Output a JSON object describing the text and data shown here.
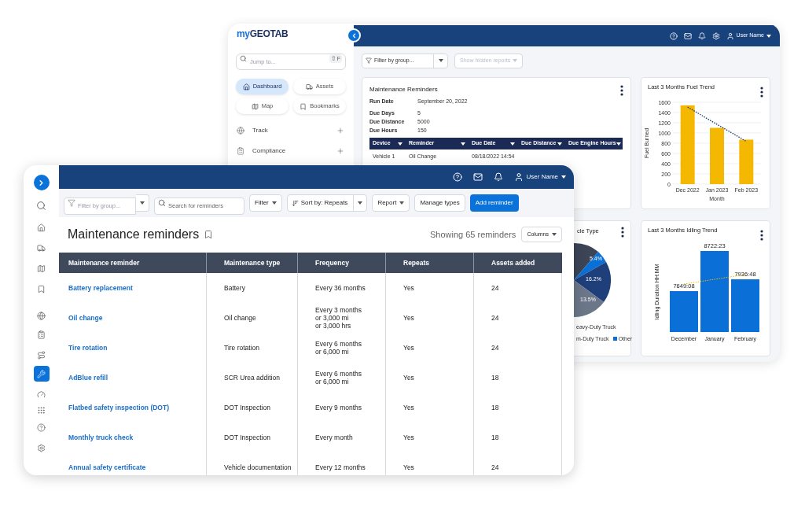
{
  "dashboard_window": {
    "logo": {
      "prefix": "my",
      "name": "GEOTAB"
    },
    "jump_search": {
      "placeholder": "Jump to...",
      "shortcut": "⇧F"
    },
    "quick_buttons": [
      {
        "label": "Dashboard",
        "selected": true
      },
      {
        "label": "Assets",
        "selected": false
      },
      {
        "label": "Map",
        "selected": false
      },
      {
        "label": "Bookmarks",
        "selected": false
      }
    ],
    "nav": [
      {
        "label": "Track"
      },
      {
        "label": "Compliance"
      }
    ],
    "header": {
      "user": "User Name"
    },
    "toolbar": {
      "group_filter": {
        "value": "Filter by group..."
      },
      "hidden_reports": {
        "label": "Show hidden reports",
        "disabled": true
      }
    },
    "reminders_card": {
      "title": "Maintenance Reminders",
      "fields": [
        {
          "label": "Run Date",
          "value": "September 20, 2022"
        },
        {
          "label": "Due Days",
          "value": "5"
        },
        {
          "label": "Due Distance",
          "value": "5000"
        },
        {
          "label": "Due Hours",
          "value": "150"
        }
      ],
      "columns": [
        "Device",
        "Reminder",
        "Due Date",
        "Due Distance",
        "Due Engine Hours"
      ],
      "rows": [
        [
          "Vehicle 1",
          "Oil Change",
          "08/18/2022 14:54"
        ]
      ]
    },
    "fuel_card": {
      "title": "Last 3 Months Fuel Trend",
      "chart_data": {
        "type": "bar",
        "xlabel": "Month",
        "ylabel": "Fuel Burned",
        "categories": [
          "Dec 2022",
          "Jan 2023",
          "Feb 2023"
        ],
        "series": [
          {
            "color": "#f5b800",
            "values": [
              1540,
              1100,
              870
            ]
          }
        ],
        "ylim": [
          0,
          1600
        ],
        "yticks": [
          0,
          200,
          400,
          600,
          800,
          1000,
          1200,
          1400,
          1600
        ],
        "grid": true
      }
    },
    "pie_card": {
      "title": "cle Type",
      "slice_labels": [
        "5.4%",
        "16.2%",
        "13.5%"
      ],
      "legend": [
        {
          "label": "eavy-Duty Truck"
        },
        {
          "label": "m-Duty Truck"
        },
        {
          "label": "Other",
          "color": "#0a6fd6"
        }
      ]
    },
    "idling_card": {
      "title": "Last 3 Months Idling Trend",
      "chart": {
        "ylabel": "Idling Duration HH:MM",
        "categories": [
          "December",
          "January",
          "February"
        ],
        "value_labels": [
          "7649:08",
          "8722:23",
          "7936:48"
        ]
      }
    }
  },
  "reminders_window": {
    "rail": [
      {
        "selected": false
      },
      {
        "selected": false
      },
      {
        "selected": false
      },
      {
        "selected": false
      },
      {
        "selected": false
      },
      {
        "selected": false
      },
      {
        "selected": false
      },
      {
        "selected": false
      },
      {
        "selected": true
      },
      {
        "selected": false
      },
      {
        "selected": false
      },
      {
        "selected": false
      },
      {
        "selected": false
      }
    ],
    "header": {
      "user": "User Name"
    },
    "toolbar": {
      "group_filter": {
        "placeholder": "Filter by group..."
      },
      "search": {
        "placeholder": "Search for reminders"
      },
      "filter": "Filter",
      "sort": "Sort by: Repeats",
      "report": "Report",
      "manage_types": "Manage types",
      "add": "Add reminder"
    },
    "title": "Maintenance reminders",
    "count": "Showing 65 reminders",
    "columns_button": "Columns",
    "table": {
      "columns": [
        "Maintenance reminder",
        "Maintenance type",
        "Frequency",
        "Repeats",
        "Assets added"
      ],
      "rows": [
        {
          "reminder": "Battery replacement",
          "type": "Battery",
          "frequency": "Every 36 months",
          "repeats": "Yes",
          "assets": "24"
        },
        {
          "reminder": "Oil change",
          "type": "Oil change",
          "frequency": "Every 3 months\nor 3,000 mi\nor 3,000 hrs",
          "repeats": "Yes",
          "assets": "24"
        },
        {
          "reminder": "Tire rotation",
          "type": "Tire rotation",
          "frequency": "Every 6 months\nor 6,000 mi",
          "repeats": "Yes",
          "assets": "24"
        },
        {
          "reminder": "AdBlue refill",
          "type": "SCR Urea addition",
          "frequency": "Every 6 months\nor 6,000 mi",
          "repeats": "Yes",
          "assets": "18"
        },
        {
          "reminder": "Flatbed safety inspection (DOT)",
          "type": "DOT Inspection",
          "frequency": "Every 9 months",
          "repeats": "Yes",
          "assets": "18"
        },
        {
          "reminder": "Monthly truck check",
          "type": "DOT Inspection",
          "frequency": "Every month",
          "repeats": "Yes",
          "assets": "18"
        },
        {
          "reminder": "Annual safety certificate",
          "type": "Vehicle documentation",
          "frequency": "Every 12 months",
          "repeats": "Yes",
          "assets": "24"
        }
      ]
    }
  }
}
